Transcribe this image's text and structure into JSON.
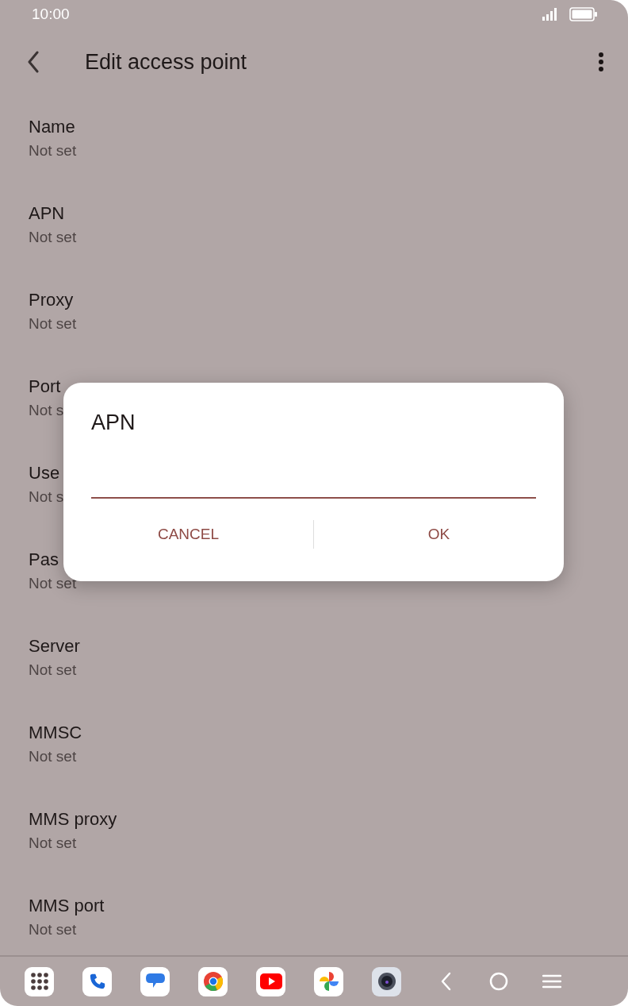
{
  "status_bar": {
    "time": "10:00"
  },
  "app_bar": {
    "title": "Edit access point"
  },
  "settings": [
    {
      "title": "Name",
      "value": "Not set"
    },
    {
      "title": "APN",
      "value": "Not set"
    },
    {
      "title": "Proxy",
      "value": "Not set"
    },
    {
      "title": "Port",
      "value": "Not s"
    },
    {
      "title": "Use",
      "value": "Not s"
    },
    {
      "title": "Pas",
      "value": "Not set"
    },
    {
      "title": "Server",
      "value": "Not set"
    },
    {
      "title": "MMSC",
      "value": "Not set"
    },
    {
      "title": "MMS proxy",
      "value": "Not set"
    },
    {
      "title": "MMS port",
      "value": "Not set"
    }
  ],
  "dialog": {
    "title": "APN",
    "buttons": [
      "CANCEL",
      "OK"
    ]
  }
}
